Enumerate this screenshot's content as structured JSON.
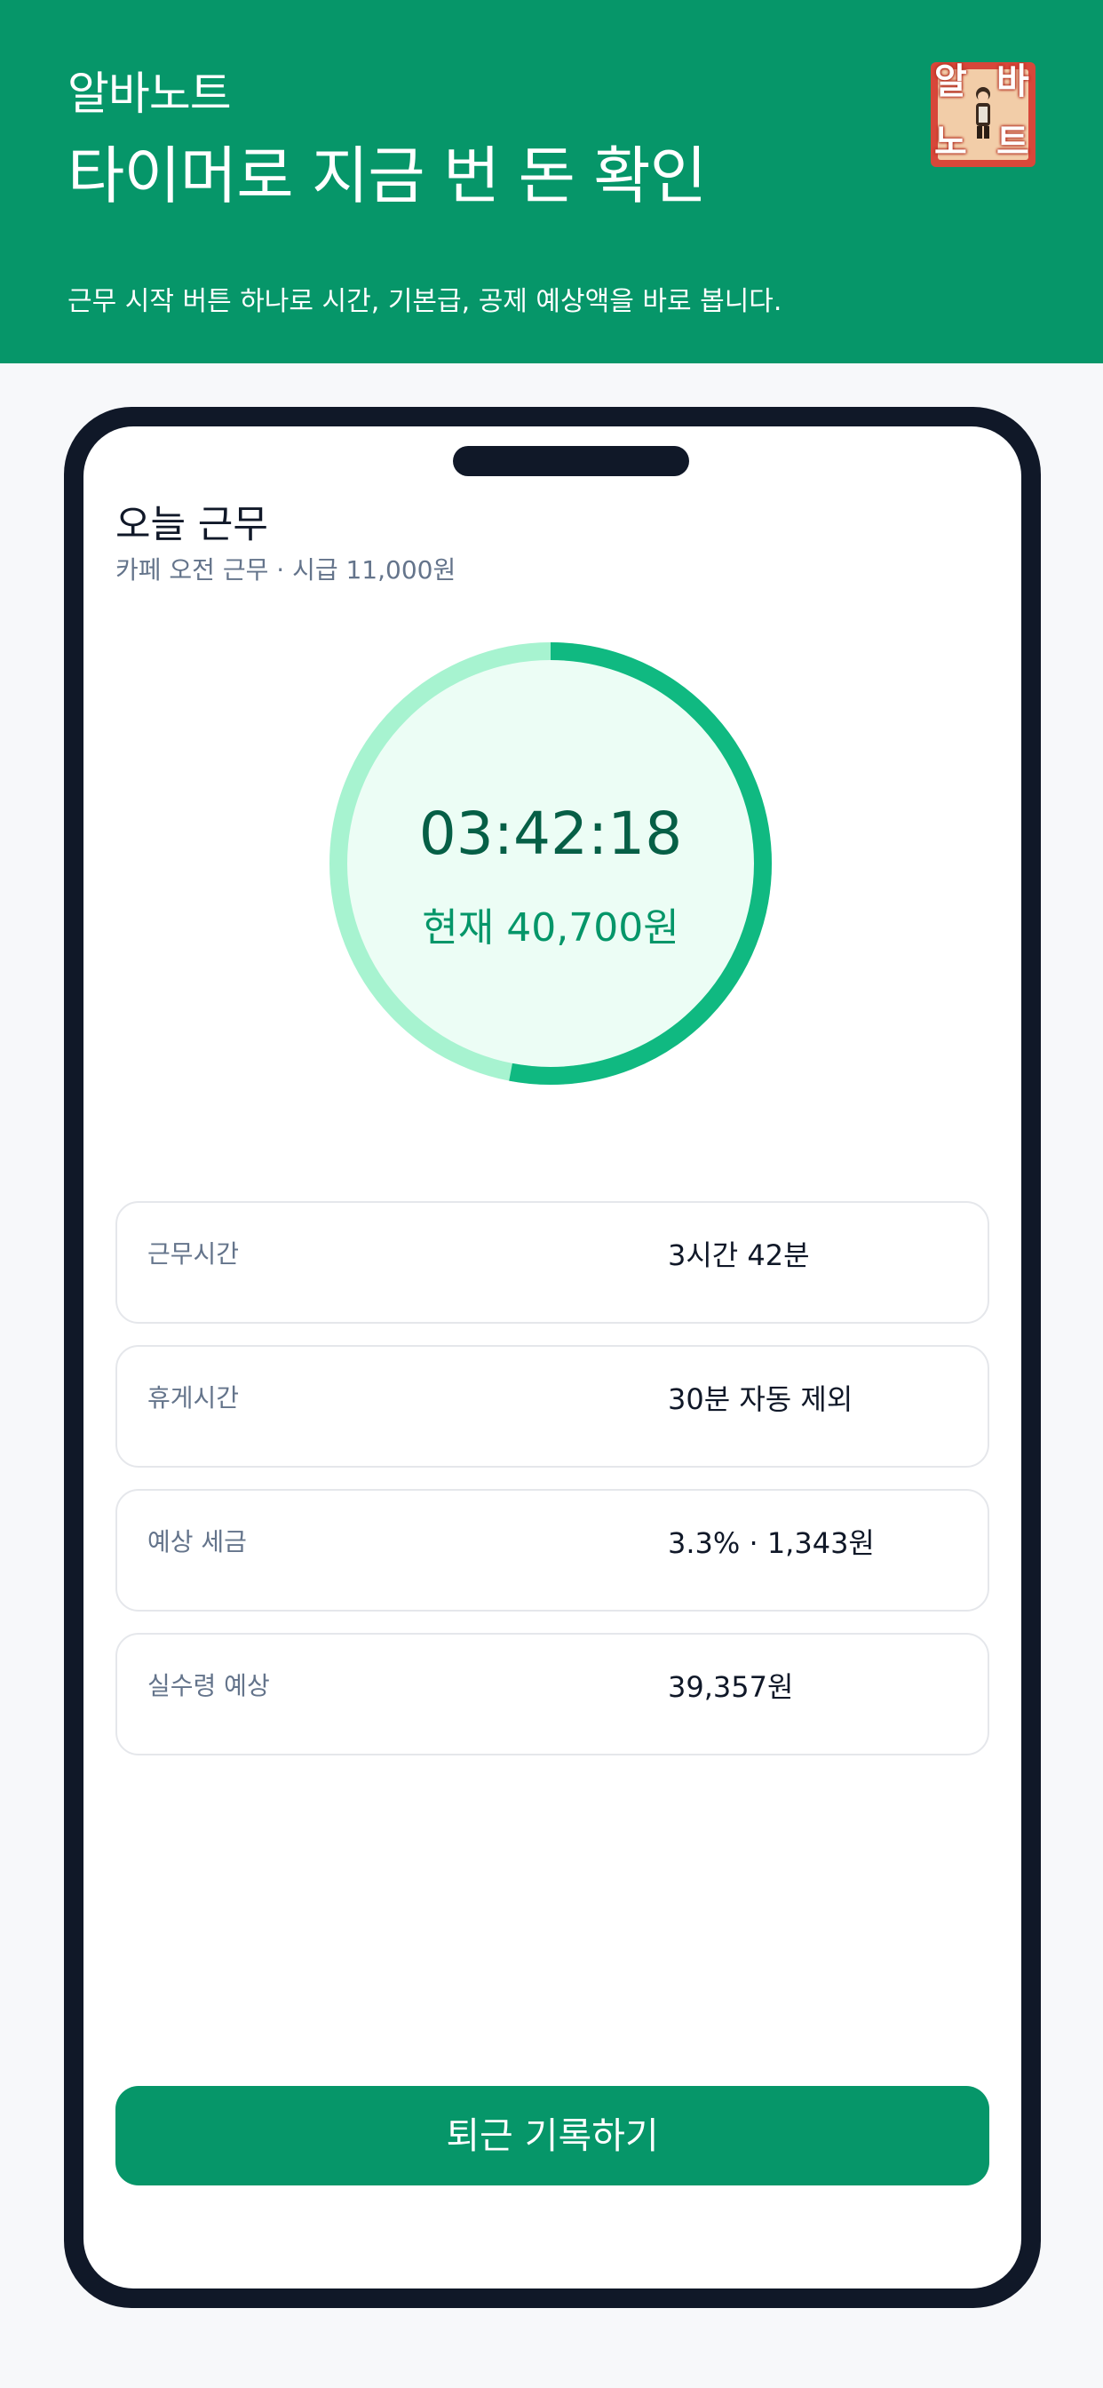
{
  "header": {
    "app_name": "알바노트",
    "headline": "타이머로 지금 번 돈 확인",
    "subline": "근무 시작 버튼 하나로 시간, 기본급, 공제 예상액을 바로 봅니다.",
    "logo_text": [
      "알",
      "바",
      "노",
      "트"
    ]
  },
  "session": {
    "title": "오늘 근무",
    "subtitle": "카페 오전 근무 · 시급 11,000원",
    "timer": "03:42:18",
    "earned": "현재 40,700원",
    "progress": 0.53
  },
  "stats": [
    {
      "label": "근무시간",
      "value": "3시간 42분"
    },
    {
      "label": "휴게시간",
      "value": "30분 자동 제외"
    },
    {
      "label": "예상 세금",
      "value": "3.3% · 1,343원"
    },
    {
      "label": "실수령 예상",
      "value": "39,357원"
    }
  ],
  "actions": {
    "checkout_label": "퇴근 기록하기"
  },
  "colors": {
    "brand": "#069669",
    "ring_fill": "#10b981",
    "ring_track": "#a7f3d0",
    "ring_inner": "#ecfdf5",
    "timer_text": "#065f46",
    "frame": "#101828"
  }
}
